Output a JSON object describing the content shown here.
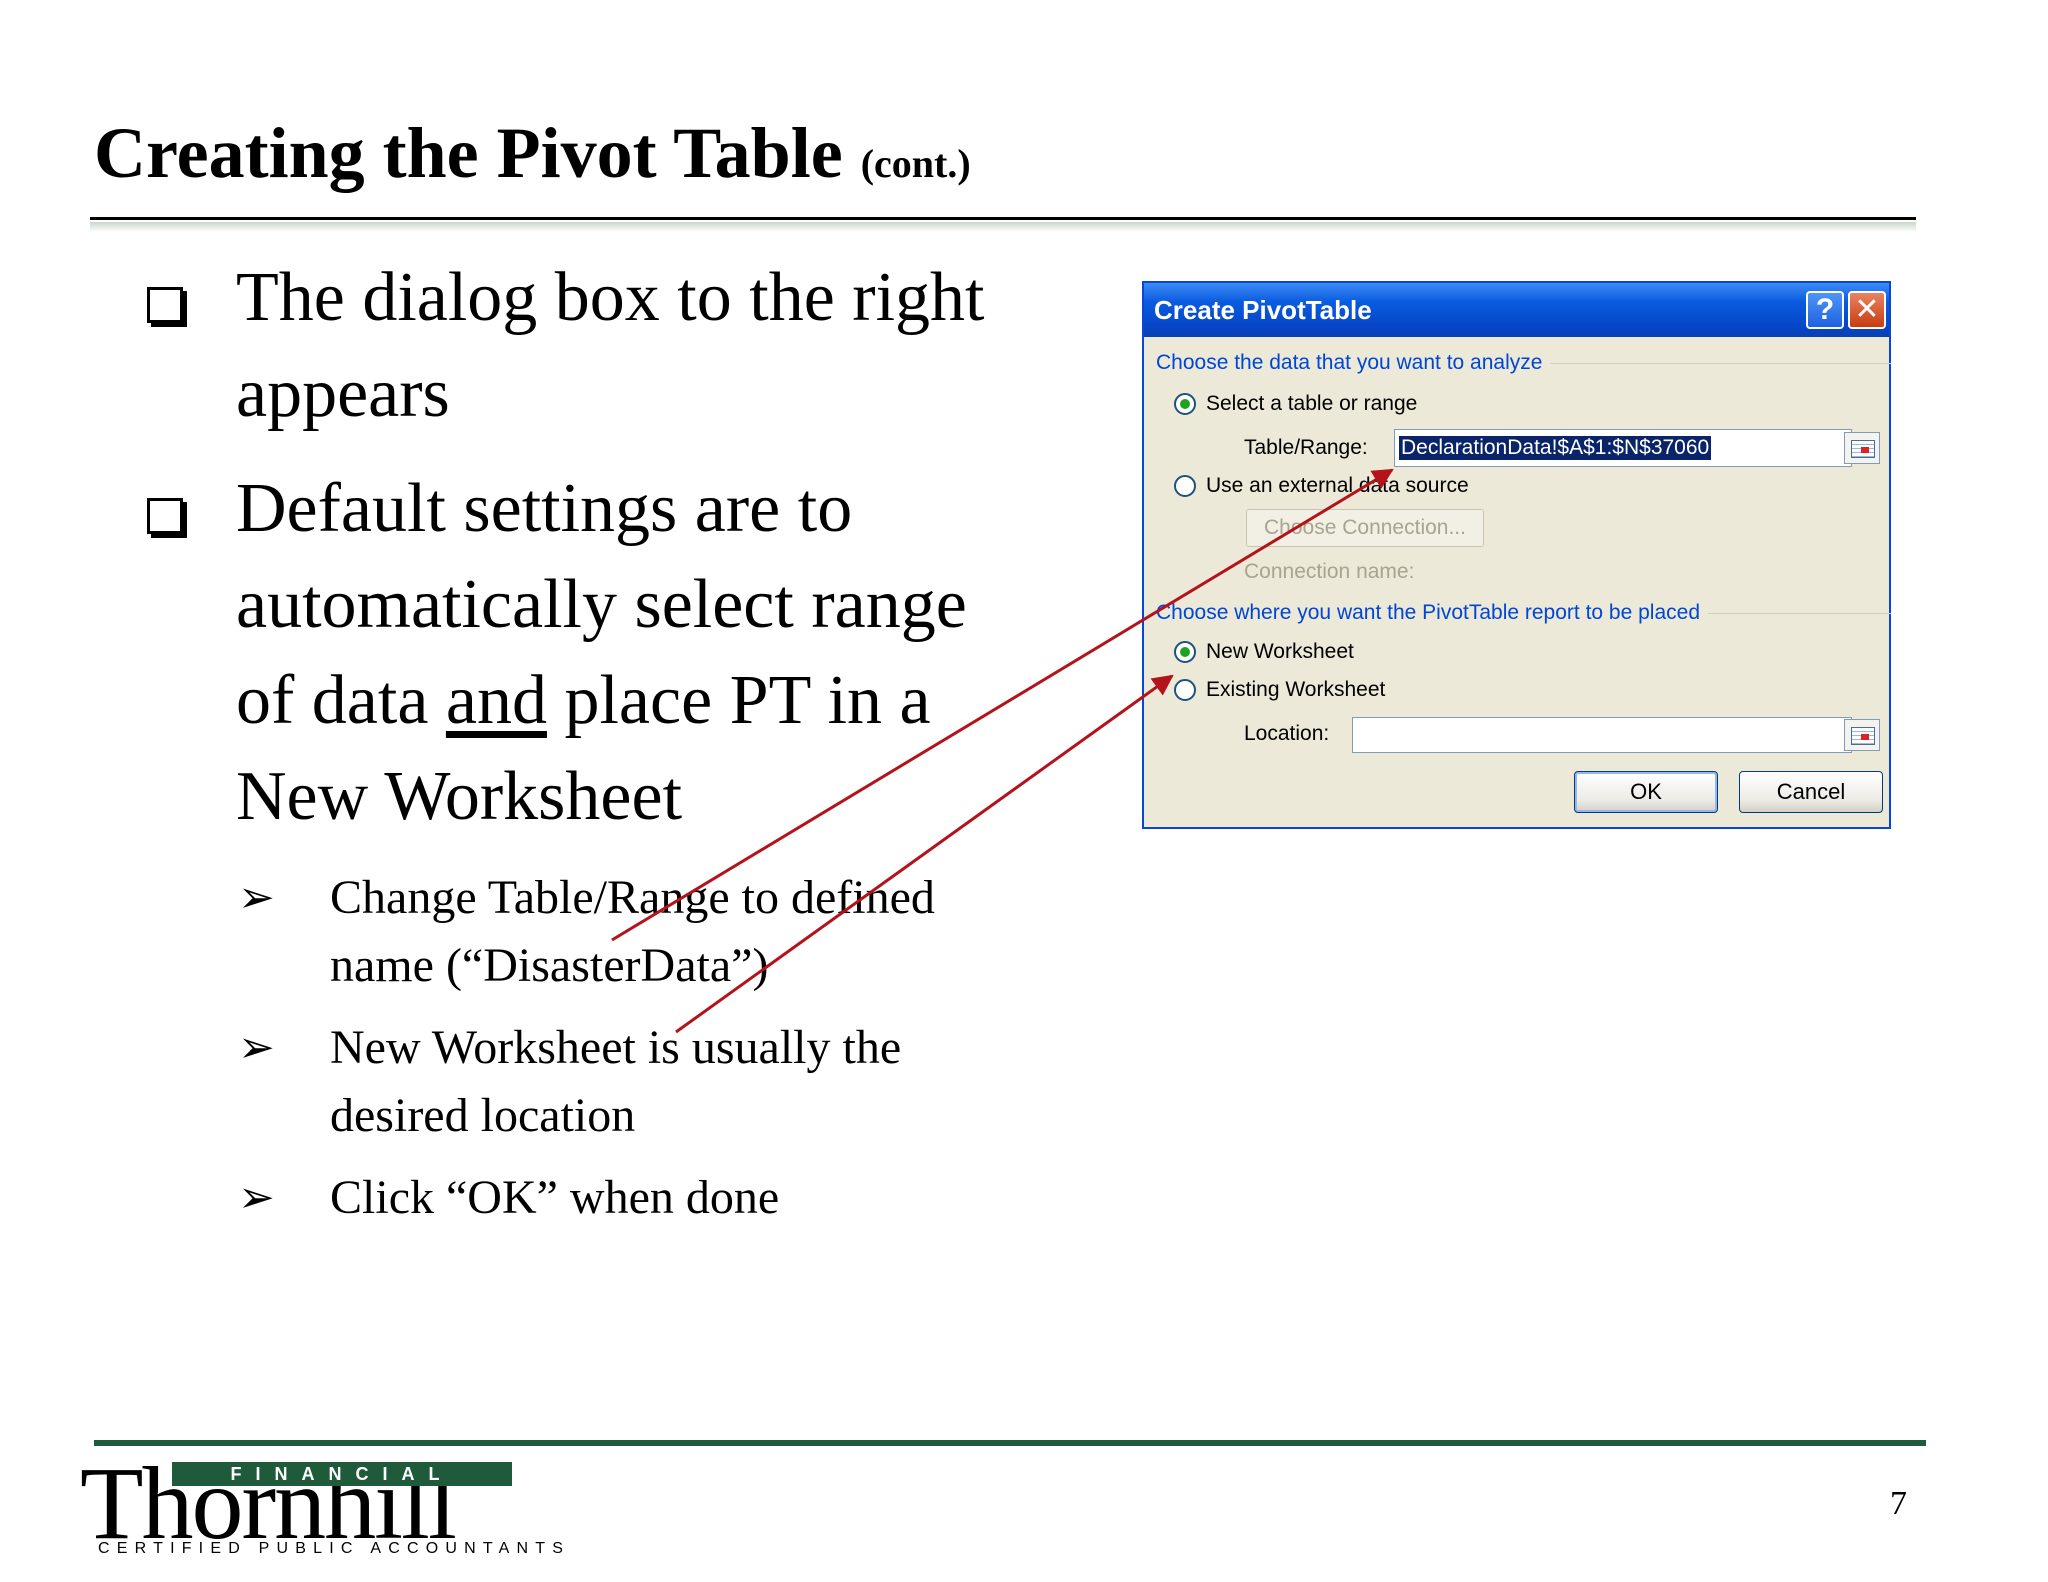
{
  "slide": {
    "title": "Creating the Pivot Table",
    "title_suffix": "(cont.)",
    "bullets": [
      {
        "lines": [
          "The dialog box to the right",
          "appears"
        ]
      },
      {
        "line1": "Default settings are to",
        "line2": "automatically select range",
        "line3_pre": "of data ",
        "line3_u": "and",
        "line3_post": " place PT in a",
        "line4": "New Worksheet"
      }
    ],
    "sub_bullets": [
      {
        "lines": [
          "Change Table/Range to defined",
          "name (“DisasterData”)"
        ]
      },
      {
        "lines": [
          "New Worksheet is usually the",
          "desired location"
        ]
      },
      {
        "lines": [
          "Click “OK” when done"
        ]
      }
    ],
    "arrowhead_glyph": "➢",
    "page_number": "7"
  },
  "dialog": {
    "title": "Create PivotTable",
    "help_label": "?",
    "close_label": "✕",
    "group1_label": "Choose the data that you want to analyze",
    "option_select_table": "Select a table or range",
    "table_range_label": "Table/Range:",
    "table_range_value": "DeclarationData!$A$1:$N$37060",
    "option_external": "Use an external data source",
    "choose_connection_label": "Choose Connection...",
    "connection_name_label": "Connection name:",
    "group2_label": "Choose where you want the PivotTable report to be placed",
    "option_new_worksheet": "New Worksheet",
    "option_existing_worksheet": "Existing Worksheet",
    "location_label": "Location:",
    "location_value": "",
    "ok_label": "OK",
    "cancel_label": "Cancel"
  },
  "logo": {
    "financial": "FINANCIAL",
    "name": "Thornhill",
    "tagline": "CERTIFIED PUBLIC ACCOUNTANTS"
  },
  "colors": {
    "accent_green": "#1f5a3a",
    "dialog_blue": "#0a46d6",
    "annotation_red": "#b3131b"
  }
}
